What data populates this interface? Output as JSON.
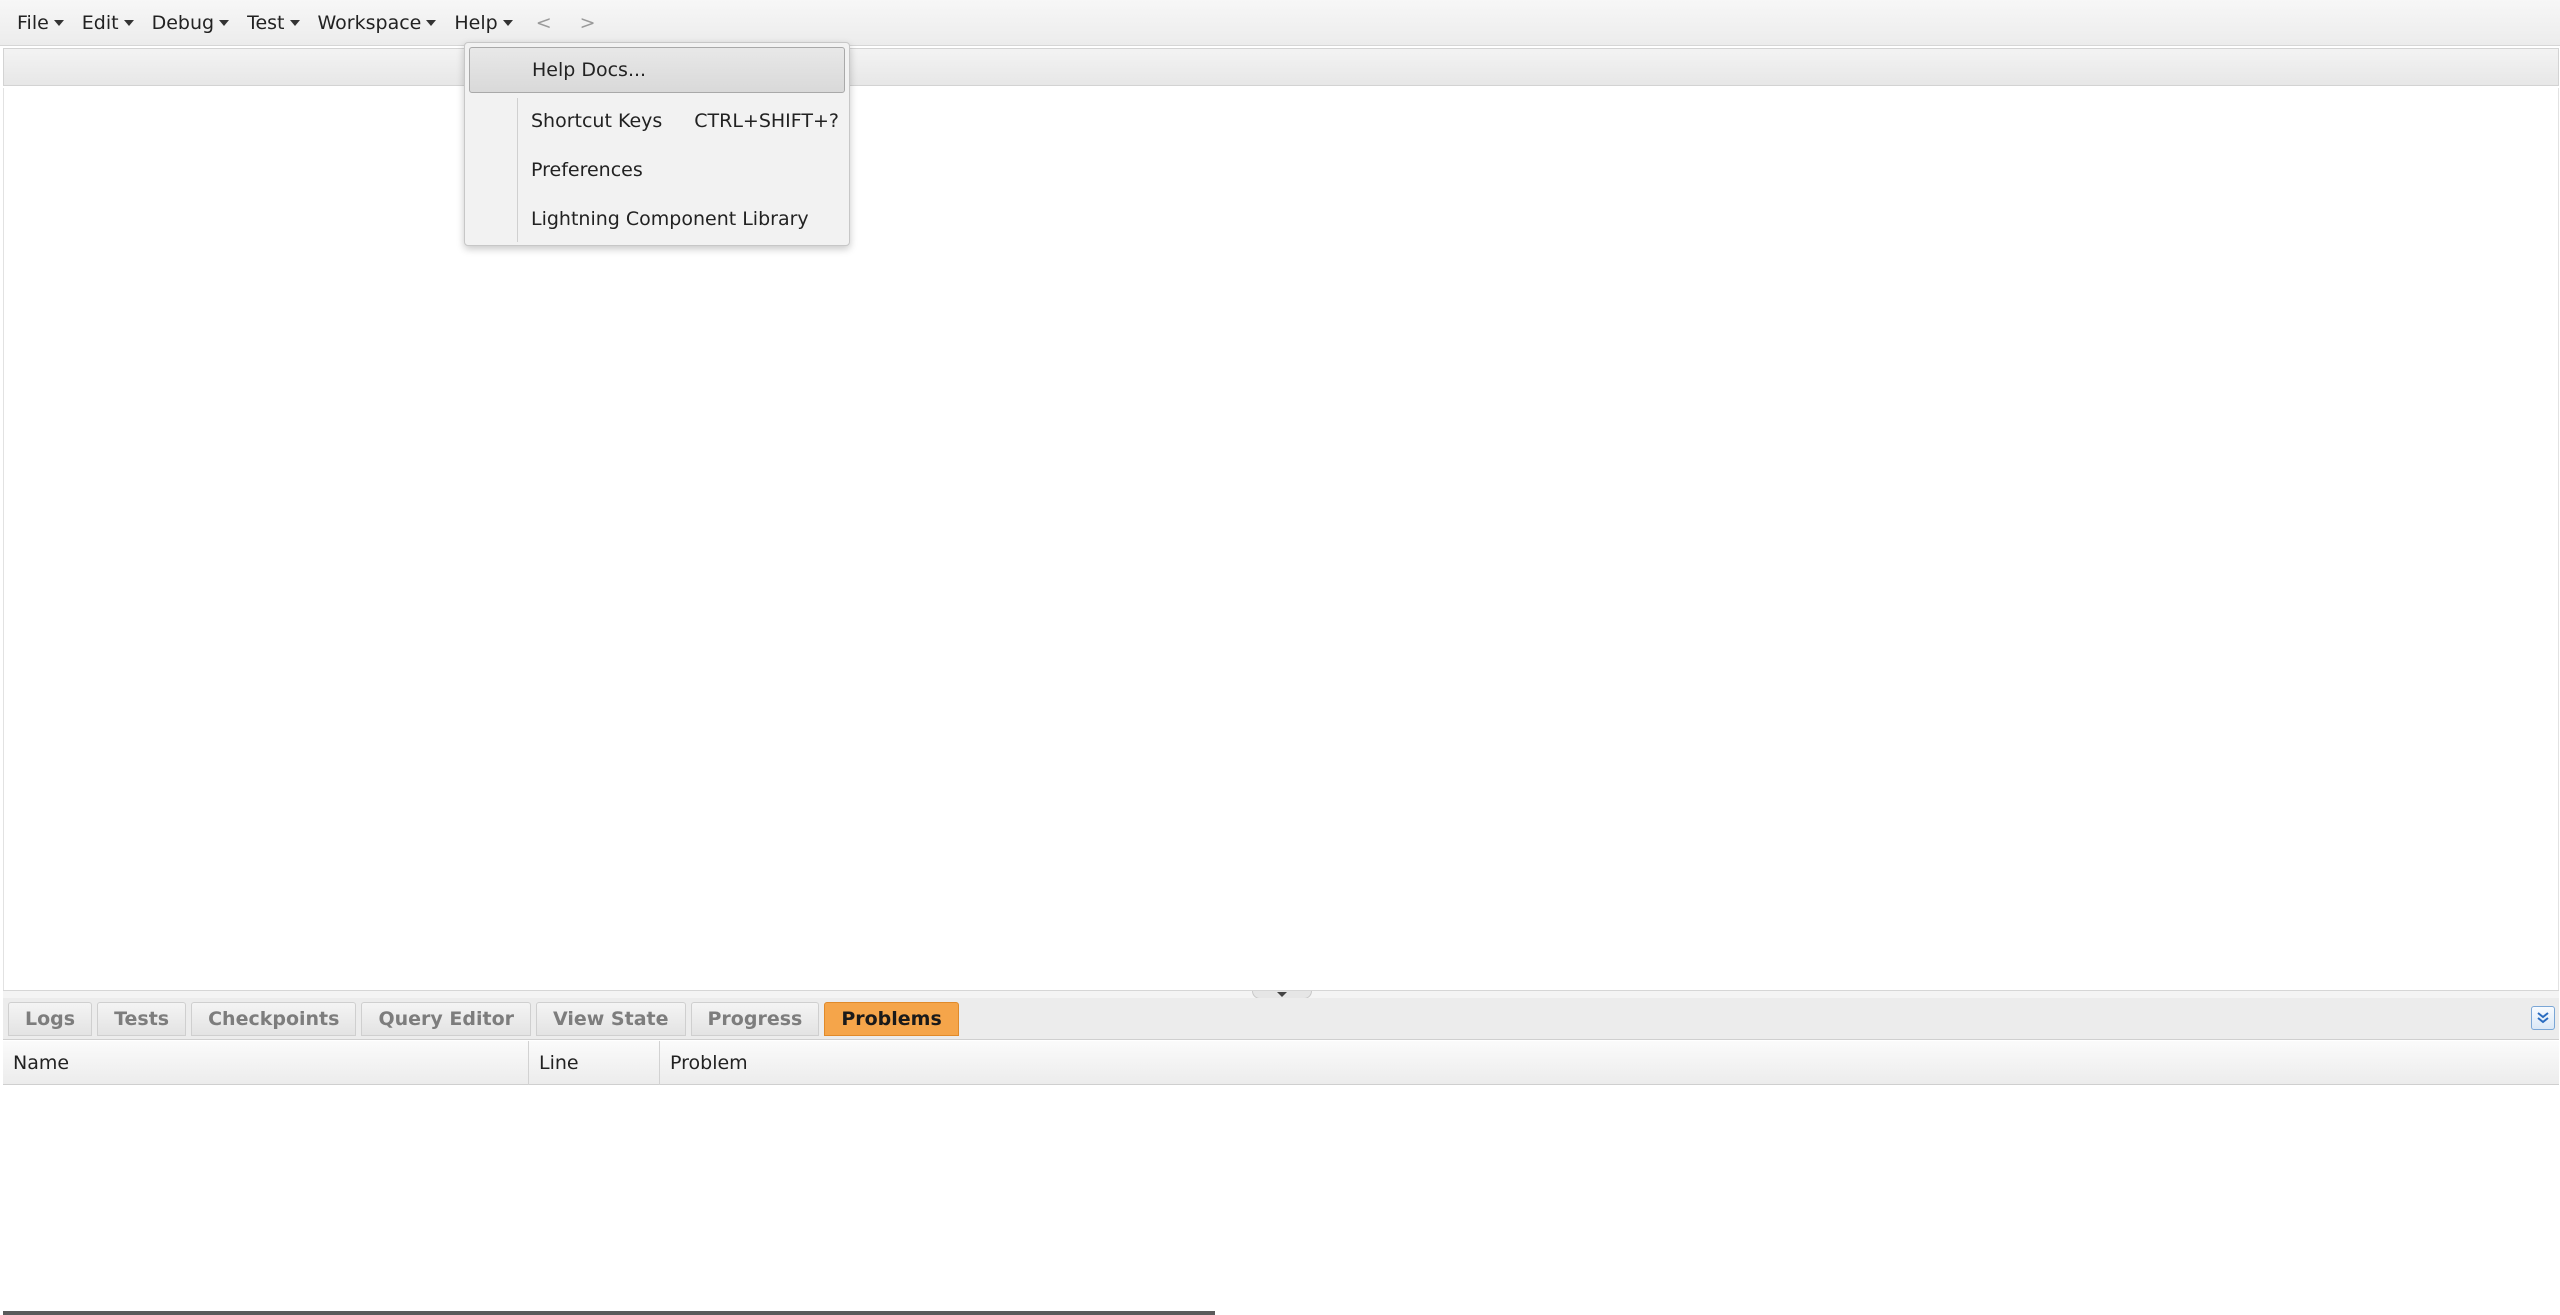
{
  "menubar": {
    "items": [
      {
        "label": "File"
      },
      {
        "label": "Edit"
      },
      {
        "label": "Debug"
      },
      {
        "label": "Test"
      },
      {
        "label": "Workspace"
      },
      {
        "label": "Help"
      }
    ],
    "back_label": "<",
    "forward_label": ">"
  },
  "help_menu": {
    "items": [
      {
        "label": "Help Docs...",
        "shortcut": ""
      },
      {
        "label": "Shortcut Keys",
        "shortcut": "CTRL+SHIFT+?"
      },
      {
        "label": "Preferences",
        "shortcut": ""
      },
      {
        "label": "Lightning Component Library",
        "shortcut": ""
      }
    ]
  },
  "bottom_panel": {
    "tabs": [
      {
        "label": "Logs"
      },
      {
        "label": "Tests"
      },
      {
        "label": "Checkpoints"
      },
      {
        "label": "Query Editor"
      },
      {
        "label": "View State"
      },
      {
        "label": "Progress"
      },
      {
        "label": "Problems",
        "active": true
      }
    ],
    "columns": [
      "Name",
      "Line",
      "Problem"
    ]
  },
  "colors": {
    "active_tab": "#f5a54a"
  }
}
